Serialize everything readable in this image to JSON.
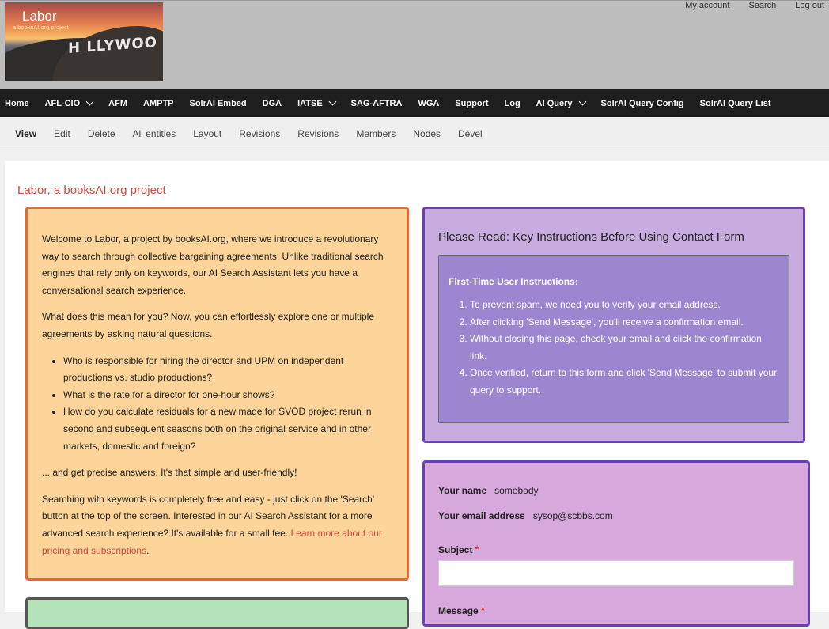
{
  "header": {
    "logo_title": "Labor",
    "logo_subtitle": "a booksAI.org project",
    "logo_sign": "H LLYWOO",
    "top_links": [
      "My account",
      "Search",
      "Log out"
    ]
  },
  "main_nav": [
    {
      "label": "Home",
      "dropdown": false
    },
    {
      "label": "AFL-CIO",
      "dropdown": true
    },
    {
      "label": "AFM",
      "dropdown": false
    },
    {
      "label": "AMPTP",
      "dropdown": false
    },
    {
      "label": "SolrAI Embed",
      "dropdown": false
    },
    {
      "label": "DGA",
      "dropdown": false
    },
    {
      "label": "IATSE",
      "dropdown": true
    },
    {
      "label": "SAG-AFTRA",
      "dropdown": false
    },
    {
      "label": "WGA",
      "dropdown": false
    },
    {
      "label": "Support",
      "dropdown": false
    },
    {
      "label": "Log",
      "dropdown": false
    },
    {
      "label": "AI Query",
      "dropdown": true
    },
    {
      "label": "SolrAI Query Config",
      "dropdown": false
    },
    {
      "label": "SolrAI Query List",
      "dropdown": false
    }
  ],
  "tabs": [
    "View",
    "Edit",
    "Delete",
    "All entities",
    "Layout",
    "Revisions",
    "Revisions",
    "Members",
    "Nodes",
    "Devel"
  ],
  "page_title": "Labor, a booksAI.org project",
  "intro": {
    "p1": "Welcome to Labor, a project by booksAI.org, where we introduce a revolutionary way to search through collective bargaining agreements. Unlike traditional search engines that rely only on keywords, our AI Search Assistant lets you have a conversational search experience.",
    "p2": "What does this mean for you? Now, you can effortlessly explore one or multiple agreements by asking natural questions.",
    "bullets": [
      "Who is responsible for hiring the director and UPM on independent productions vs. studio productions?",
      "What is the rate for a director for one-hour shows?",
      "How do you calculate residuals for a new made for SVOD project rerun in second and subsequent seasons both on the original service and in other markets, domestic and foreign?"
    ],
    "p3": "... and get precise answers. It's that simple and user-friendly!",
    "p4_text": "Searching with keywords is completely free and easy - just click on the 'Search' button at the top of the screen. Interested in our AI Search Assistant for a more advanced search experience? It's available for a small fee. ",
    "p4_link": "Learn more about our pricing and subscriptions",
    "p4_end": "."
  },
  "instructions": {
    "heading": "Please Read: Key Instructions Before Using Contact Form",
    "title": "First-Time User Instructions:",
    "steps": [
      "To prevent spam, we need you to verify your email address.",
      "After clicking 'Send Message', you'll receive a confirmation email.",
      "Without closing this page, check your email and click the confirmation link.",
      "Once verified, return to this form and click 'Send Message' to submit your query to support."
    ]
  },
  "contact_form": {
    "name_label": "Your name",
    "name_value": "somebody",
    "email_label": "Your email address",
    "email_value": "sysop@scbbs.com",
    "subject_label": "Subject",
    "subject_value": "",
    "message_label": "Message",
    "required_mark": "*"
  },
  "colors": {
    "intro_bg": "#fdd59a",
    "intro_border": "#e56a2e",
    "instructions_bg": "#c9acdf",
    "instructions_inner_bg": "#9d86cf",
    "form_bg": "#d6a8dc",
    "purple_border": "#6a3fb4",
    "title_red": "#d04a3a",
    "nav_bg": "#1e1e1e"
  }
}
